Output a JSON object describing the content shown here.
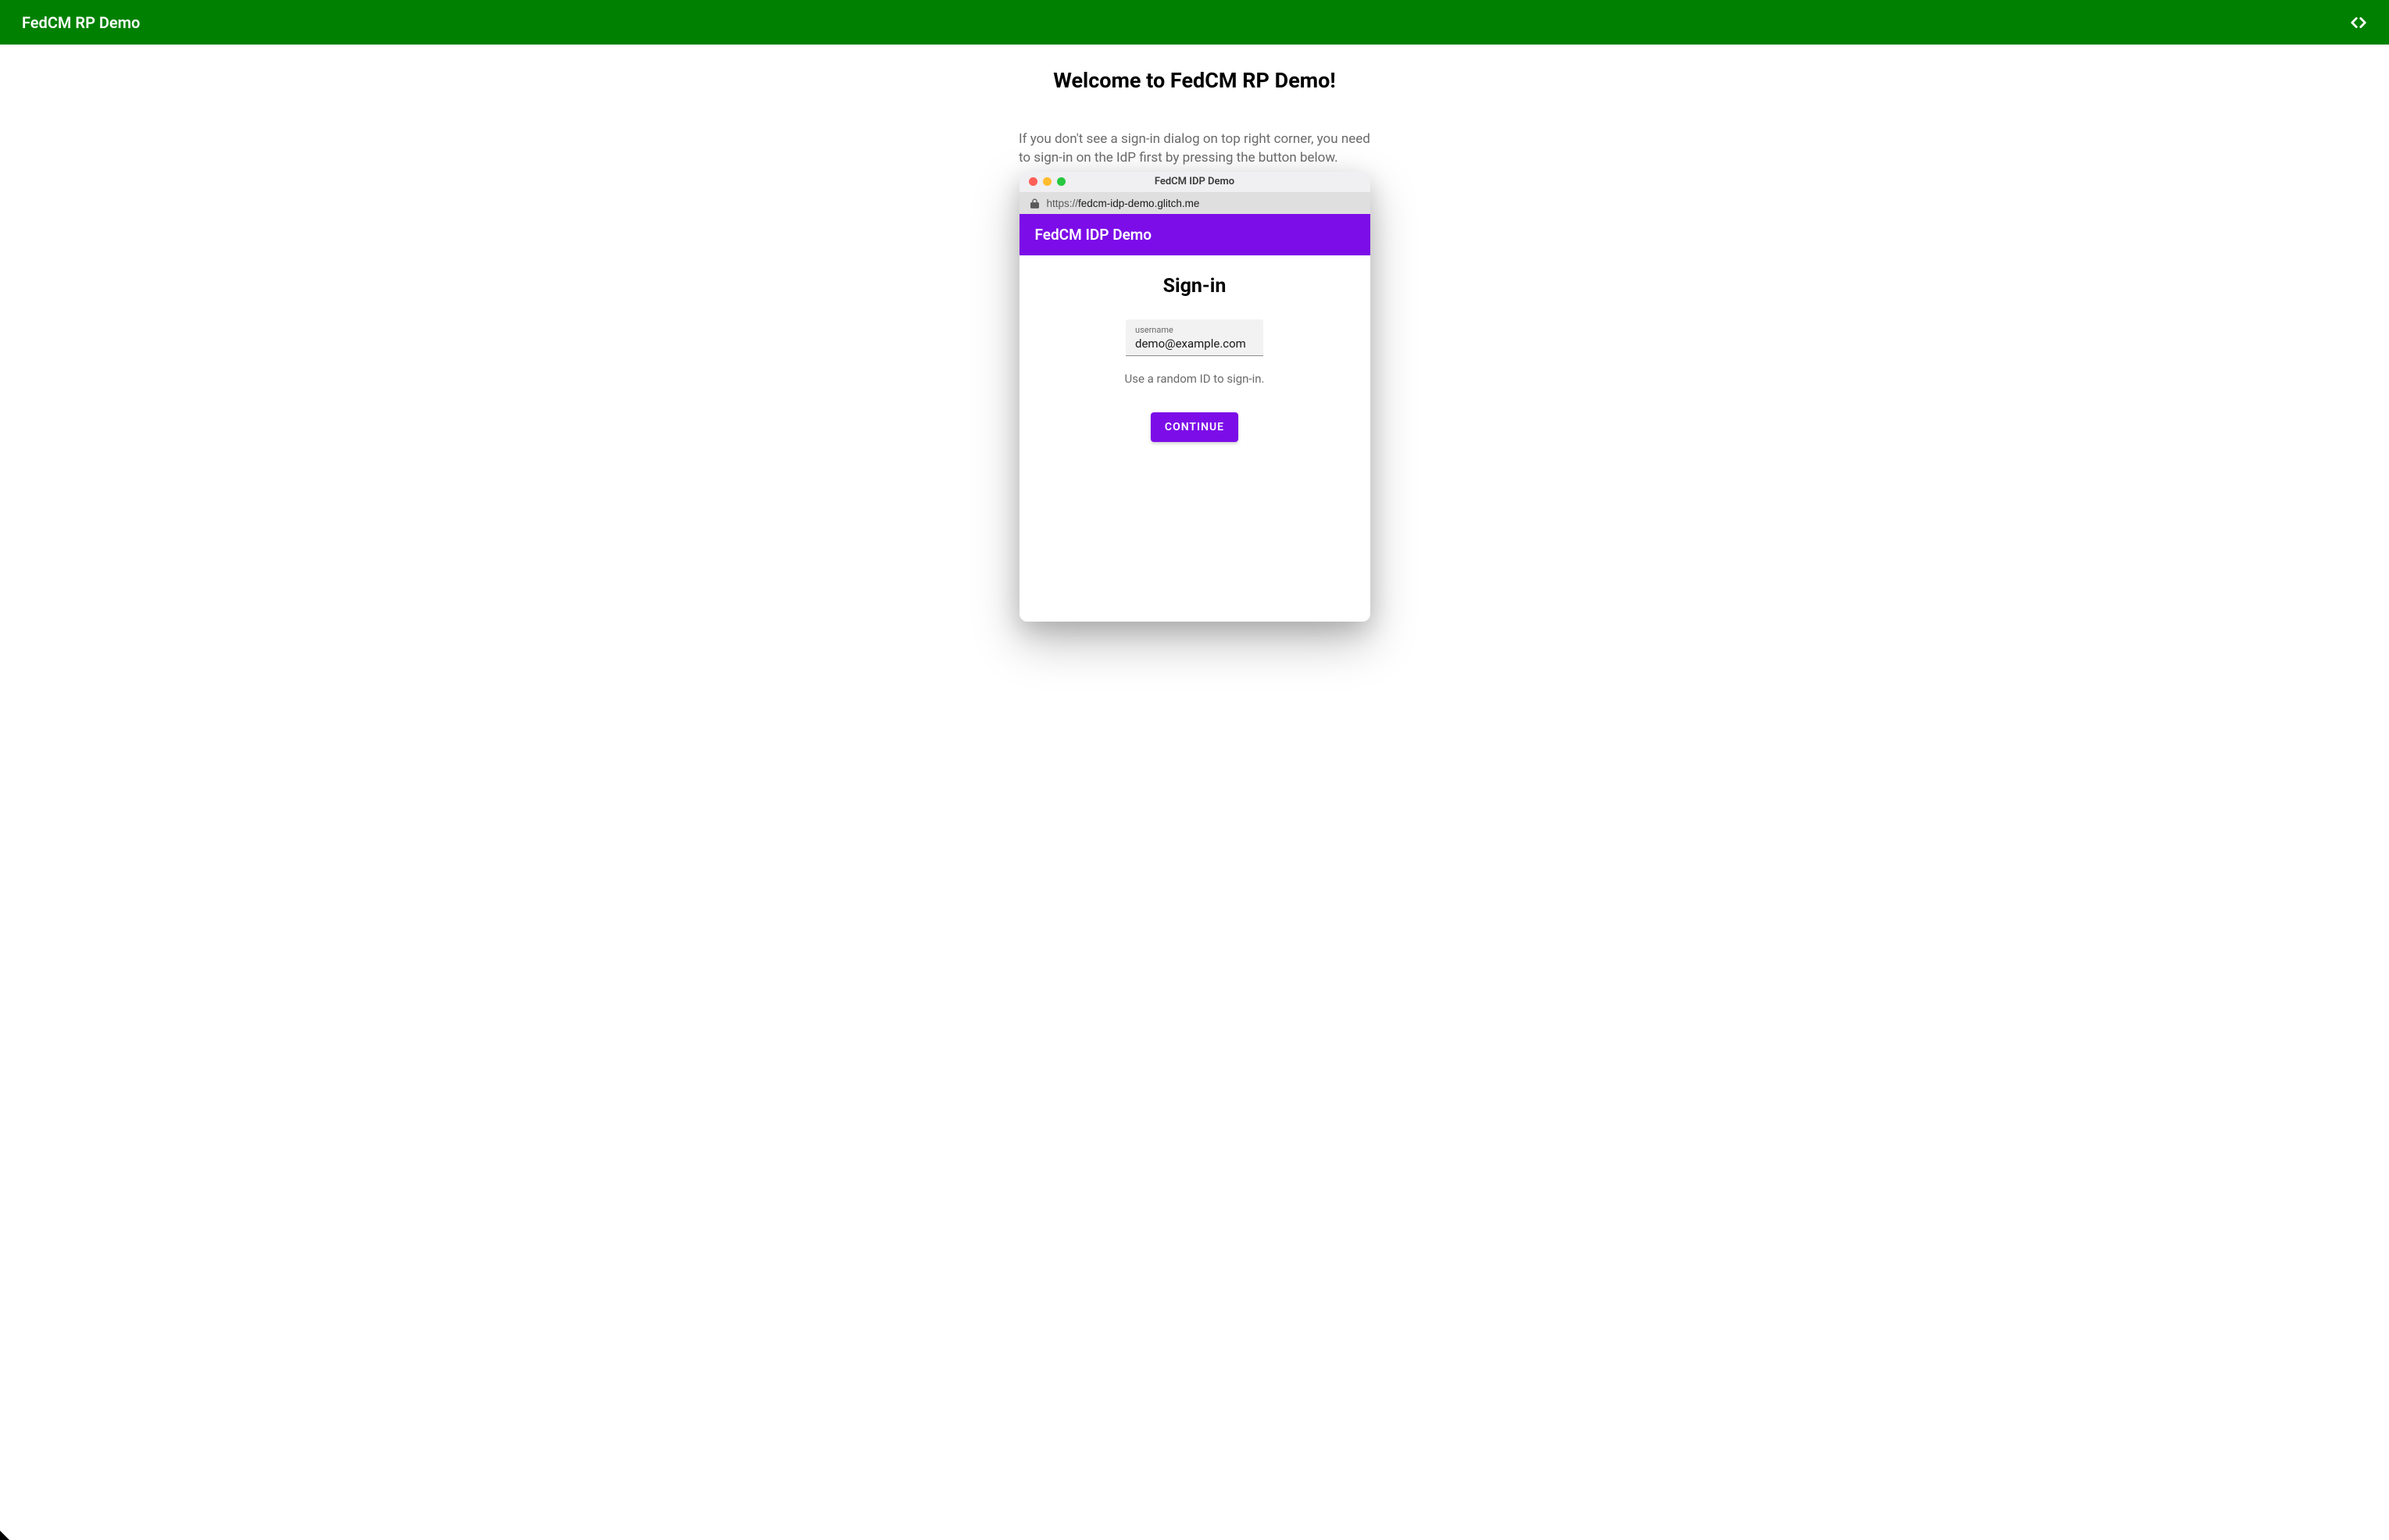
{
  "header": {
    "title": "FedCM RP Demo"
  },
  "main": {
    "welcome_heading": "Welcome to FedCM RP Demo!",
    "instruction_text": "If you don't see a sign-in dialog on top right corner, you need to sign-in on the IdP first by pressing the button below."
  },
  "popup": {
    "window_title": "FedCM IDP Demo",
    "url_protocol": "https://",
    "url_domain": "fedcm-idp-demo.glitch.me",
    "idp_header_title": "FedCM IDP Demo",
    "signin_heading": "Sign-in",
    "username_label": "username",
    "username_value": "demo@example.com",
    "helper_text": "Use a random ID to sign-in.",
    "continue_label": "CONTINUE"
  }
}
